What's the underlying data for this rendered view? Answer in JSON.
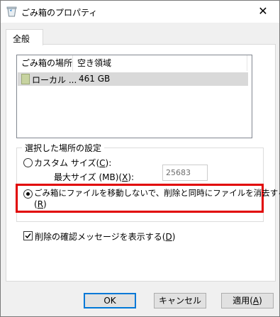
{
  "window": {
    "title": "ごみ箱のプロパティ",
    "close_glyph": "✕"
  },
  "tabs": [
    {
      "label": "全般",
      "selected": true
    }
  ],
  "locations_list": {
    "columns": [
      "ごみ箱の場所",
      "空き領域"
    ],
    "rows": [
      {
        "location": "ローカル ...",
        "free_space": "461 GB",
        "selected": true
      }
    ]
  },
  "settings_group": {
    "legend": "選択した場所の設定",
    "custom_size": {
      "label_prefix": "カスタム サイズ(",
      "mnemonic": "C",
      "label_suffix": "):",
      "selected": false
    },
    "max_size": {
      "label_prefix": "最大サイズ (MB)(",
      "mnemonic": "X",
      "label_suffix": "):",
      "value": "25683",
      "enabled": false
    },
    "no_recycle": {
      "label": "ごみ箱にファイルを移動しないで、削除と同時にファイルを消去する",
      "mnemonic_prefix": "(",
      "mnemonic": "R",
      "mnemonic_suffix": ")",
      "selected": true
    },
    "highlight_color": "#e10000"
  },
  "confirm_delete": {
    "label_prefix": "削除の確認メッセージを表示する(",
    "mnemonic": "D",
    "label_suffix": ")",
    "checked": true
  },
  "buttons": {
    "ok": "OK",
    "cancel": "キャンセル",
    "apply_prefix": "適用(",
    "apply_mnemonic": "A",
    "apply_suffix": ")"
  },
  "colors": {
    "accent": "#0078d7",
    "selection": "#d9d9d9"
  }
}
